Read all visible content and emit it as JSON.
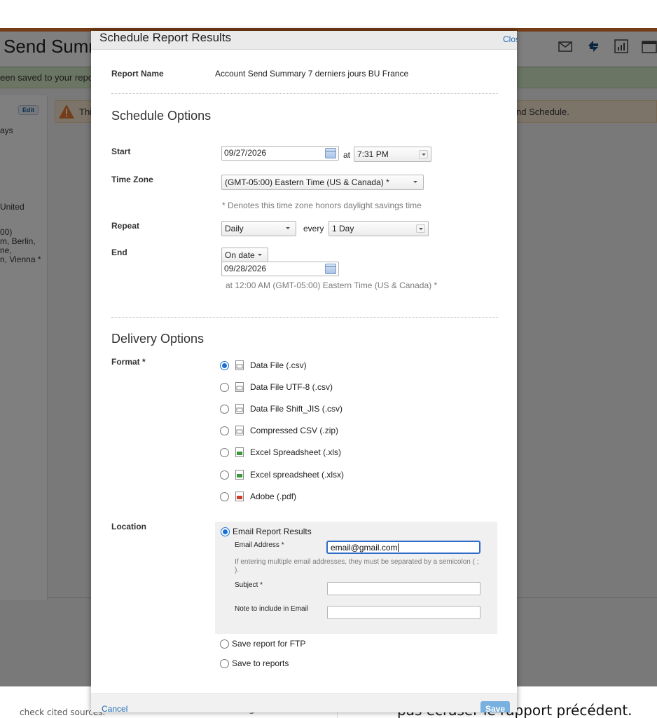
{
  "background": {
    "page_title": "Send Summ",
    "success_text": "een saved to your repor",
    "edit_label": "Edit",
    "left_column": [
      "ays",
      "United",
      "00)",
      "m, Berlin,",
      "ne,",
      "n, Vienna *"
    ],
    "warning_left": "Thi",
    "warning_right": "nd Schedule.",
    "bottom_cited": "check cited sources.",
    "bottom_mid": "g",
    "bottom_french": "pas écraser le rapport précédent."
  },
  "modal": {
    "title": "Schedule Report Results",
    "close_label": "Close",
    "report_name_label": "Report Name",
    "report_name_value": "Account Send Summary 7 derniers jours BU France",
    "schedule_options_heading": "Schedule Options",
    "start_label": "Start",
    "start_date": "09/27/2026",
    "at_label": "at",
    "start_time": "7:31 PM",
    "timezone_label": "Time Zone",
    "timezone_value": "(GMT-05:00) Eastern Time (US & Canada) *",
    "timezone_note": "* Denotes this time zone honors daylight savings time",
    "repeat_label": "Repeat",
    "repeat_value": "Daily",
    "every_label": "every",
    "every_value": "1 Day",
    "end_label": "End",
    "end_mode": "On date",
    "end_date": "09/28/2026",
    "end_note": "at 12:00 AM (GMT-05:00) Eastern Time (US & Canada) *",
    "delivery_options_heading": "Delivery Options",
    "format_label": "Format *",
    "formats": [
      {
        "label": "Data File (.csv)",
        "selected": true,
        "icon": "csv-file-icon",
        "color": "#8a8a8a"
      },
      {
        "label": "Data File UTF-8 (.csv)",
        "selected": false,
        "icon": "csv-file-icon",
        "color": "#8a8a8a"
      },
      {
        "label": "Data File Shift_JIS (.csv)",
        "selected": false,
        "icon": "csv-file-icon",
        "color": "#8a8a8a"
      },
      {
        "label": "Compressed CSV (.zip)",
        "selected": false,
        "icon": "zip-file-icon",
        "color": "#8a8a8a"
      },
      {
        "label": "Excel Spreadsheet (.xls)",
        "selected": false,
        "icon": "excel-file-icon",
        "color": "#3a9a3a"
      },
      {
        "label": "Excel spreadsheet (.xlsx)",
        "selected": false,
        "icon": "excel-file-icon",
        "color": "#3a9a3a"
      },
      {
        "label": "Adobe (.pdf)",
        "selected": false,
        "icon": "pdf-file-icon",
        "color": "#d23a2a"
      }
    ],
    "location_label": "Location",
    "location_email_label": "Email Report Results",
    "email_address_label": "Email Address *",
    "email_address_value": "email@gmail.com",
    "email_hint": "If entering multiple email addresses, they must be separated by a semicolon ( ; ).",
    "subject_label": "Subject *",
    "subject_value": "",
    "note_label": "Note to include in Email",
    "note_value": "",
    "location_ftp_label": "Save report for FTP",
    "location_reports_label": "Save to reports",
    "cancel_label": "Cancel",
    "save_label": "Save"
  }
}
